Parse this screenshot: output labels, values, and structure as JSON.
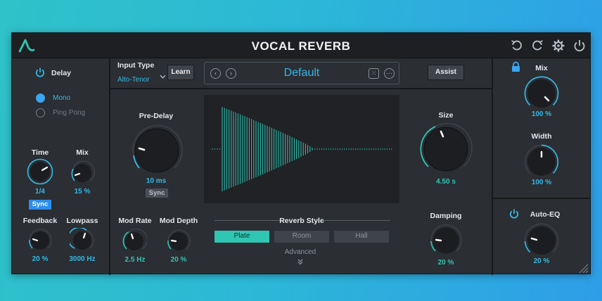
{
  "title": "VOCAL REVERB",
  "delay": {
    "label": "Delay",
    "modes": [
      "Mono",
      "Ping Pong"
    ],
    "time_label": "Time",
    "time_value": "1/4",
    "mix_label": "Mix",
    "mix_value": "15 %",
    "sync_label": "Sync",
    "feedback_label": "Feedback",
    "feedback_value": "20 %",
    "lowpass_label": "Lowpass",
    "lowpass_value": "3000 Hz"
  },
  "input": {
    "label": "Input Type",
    "value": "Alto-Tenor",
    "learn_label": "Learn"
  },
  "preset": {
    "name": "Default"
  },
  "assist_label": "Assist",
  "predelay": {
    "label": "Pre-Delay",
    "value": "10 ms",
    "sync_label": "Sync"
  },
  "size": {
    "label": "Size",
    "value": "4.50 s"
  },
  "damping": {
    "label": "Damping",
    "value": "20 %"
  },
  "modrate": {
    "label": "Mod Rate",
    "value": "2.5 Hz"
  },
  "moddepth": {
    "label": "Mod Depth",
    "value": "20 %"
  },
  "reverb_style": {
    "label": "Reverb Style",
    "options": [
      "Plate",
      "Room",
      "Hall"
    ],
    "selected": "Plate"
  },
  "advanced_label": "Advanced",
  "mix": {
    "label": "Mix",
    "value": "100 %"
  },
  "width": {
    "label": "Width",
    "value": "100 %"
  },
  "autoeq": {
    "label": "Auto-EQ",
    "value": "20 %"
  },
  "colors": {
    "accent": "#34b9e6",
    "teal": "#2fc7b4",
    "panel": "#2b2e33"
  }
}
